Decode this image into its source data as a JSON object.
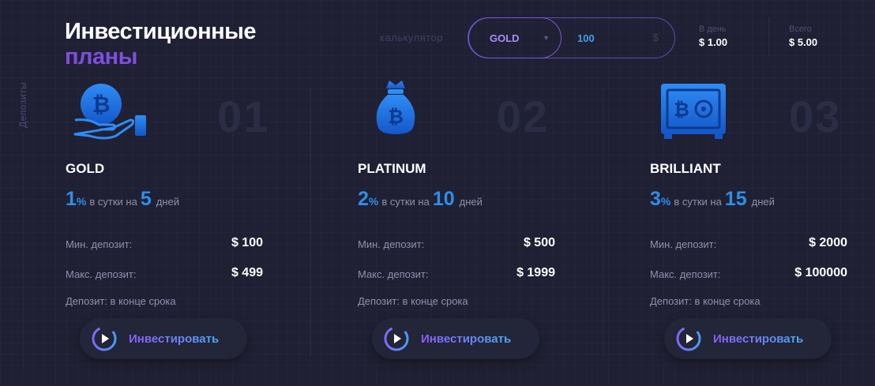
{
  "sidebar": {
    "label": "Депозиты"
  },
  "header": {
    "title_line1": "Инвестиционные",
    "title_line2": "планы"
  },
  "calculator": {
    "label": "калькулятор",
    "selected_plan": "GOLD",
    "amount": "100",
    "currency": "$",
    "per_day_label": "В день",
    "per_day_value": "$ 1.00",
    "total_label": "Всего",
    "total_value": "$ 5.00"
  },
  "colors": {
    "accent_purple": "#7e4fe0",
    "accent_blue": "#2f8eea",
    "background": "#1f2033"
  },
  "plans": [
    {
      "number": "01",
      "name": "GOLD",
      "icon": "bitcoin-hand-icon",
      "percent": "1",
      "percent_unit": "%",
      "per_day_text": "в сутки на",
      "days": "5",
      "days_text": "дней",
      "min_label": "Мин. депозит:",
      "min_value": "$ 100",
      "max_label": "Макс. депозит:",
      "max_value": "$ 499",
      "term": "Депозит: в конце срока",
      "button": "Инвестировать"
    },
    {
      "number": "02",
      "name": "PLATINUM",
      "icon": "bitcoin-bag-icon",
      "percent": "2",
      "percent_unit": "%",
      "per_day_text": "в сутки на",
      "days": "10",
      "days_text": "дней",
      "min_label": "Мин. депозит:",
      "min_value": "$ 500",
      "max_label": "Макс. депозит:",
      "max_value": "$ 1999",
      "term": "Депозит: в конце срока",
      "button": "Инвестировать"
    },
    {
      "number": "03",
      "name": "BRILLIANT",
      "icon": "bitcoin-safe-icon",
      "percent": "3",
      "percent_unit": "%",
      "per_day_text": "в сутки на",
      "days": "15",
      "days_text": "дней",
      "min_label": "Мин. депозит:",
      "min_value": "$ 2000",
      "max_label": "Макс. депозит:",
      "max_value": "$ 100000",
      "term": "Депозит: в конце срока",
      "button": "Инвестировать"
    }
  ]
}
